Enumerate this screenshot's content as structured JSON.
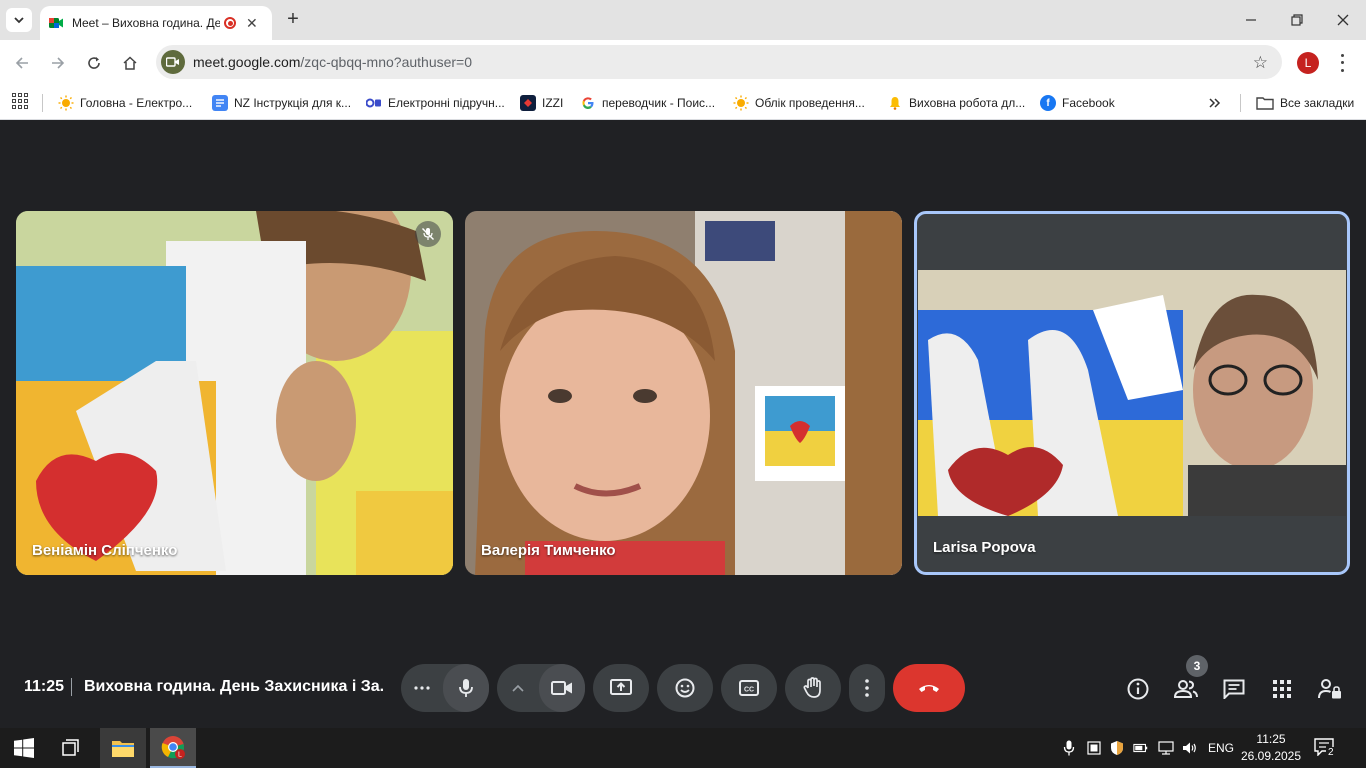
{
  "browser": {
    "tab_title": "Meet – Виховна година. Де",
    "url_host": "meet.google.com",
    "url_path": "/zqc-qbqq-mno?authuser=0",
    "profile_initial": "L",
    "bookmarks": [
      {
        "label": "Головна - Електро...",
        "icon": "sun-icon",
        "color": "#f9ab00"
      },
      {
        "label": "NZ Інструкція для к...",
        "icon": "docs-icon",
        "color": "#4285f4"
      },
      {
        "label": "Електронні підручн...",
        "icon": "classroom-icon",
        "color": "#3b4cca"
      },
      {
        "label": "IZZI",
        "icon": "izzi-icon",
        "color": "#0f1f3d"
      },
      {
        "label": "переводчик - Поис...",
        "icon": "google-icon",
        "color": "#4285f4"
      },
      {
        "label": "Облік проведення...",
        "icon": "sun-icon",
        "color": "#f9ab00"
      },
      {
        "label": "Виховна робота дл...",
        "icon": "bell-icon",
        "color": "#fbbc04"
      },
      {
        "label": "Facebook",
        "icon": "facebook-icon",
        "color": "#1877f2"
      }
    ],
    "all_bookmarks_label": "Все закладки"
  },
  "meet": {
    "participants": [
      {
        "name": "Веніамін Сліпченко",
        "muted": true
      },
      {
        "name": "Валерія Тимченко",
        "muted": false
      },
      {
        "name": "Larisa Popova",
        "muted": false,
        "active_speaker": true
      }
    ],
    "time": "11:25",
    "meeting_title": "Виховна година. День Захисника і За...",
    "people_count": "3",
    "accent": "#a8c7fa",
    "end_call_color": "#dc362e"
  },
  "taskbar": {
    "language": "ENG",
    "time": "11:25",
    "date": "26.09.2025",
    "notifications": "2"
  }
}
